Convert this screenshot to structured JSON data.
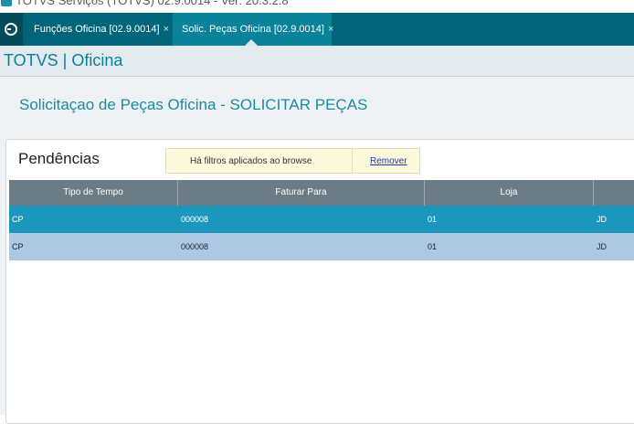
{
  "window": {
    "title": "TOTVS Serviços (TOTVS) 02.9.0014 - Ver: 20.3.2.8"
  },
  "tabs": [
    {
      "label": "Funções Oficina [02.9.0014]",
      "close": "×"
    },
    {
      "label": "Solic. Peças Oficina [02.9.0014]",
      "close": "×"
    }
  ],
  "app": {
    "title": "TOTVS | Oficina"
  },
  "page": {
    "title": "Solicitaçao de Peças Oficina - SOLICITAR PEÇAS"
  },
  "pendencias": {
    "title": "Pendências",
    "filter_notice": "Há filtros aplicados ao browse",
    "remove_link": "Remover"
  },
  "grid": {
    "columns": [
      "Tipo de Tempo",
      "Faturar Para",
      "Loja",
      ""
    ],
    "rows": [
      [
        "CP",
        "000008",
        "01",
        "JD"
      ],
      [
        "CP",
        "000008",
        "01",
        "JD"
      ]
    ]
  },
  "colors": {
    "tabbar": "#006579",
    "accent": "#1b8ba3",
    "selected_row": "#1b96bd",
    "alt_row": "#adc8e3",
    "header": "#6b7c86"
  }
}
